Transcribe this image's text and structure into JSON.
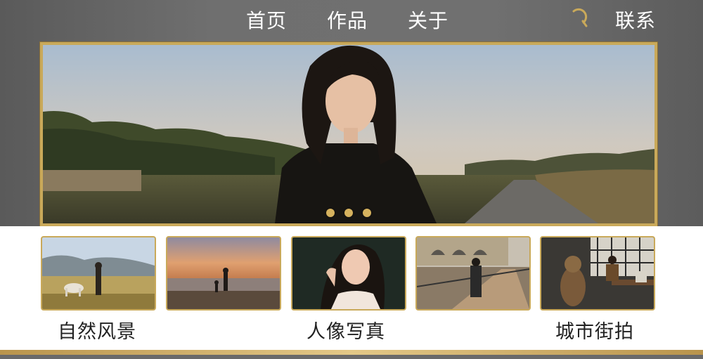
{
  "nav": {
    "home": "首页",
    "works": "作品",
    "about": "关于",
    "contact": "联系",
    "search_icon": "search-icon"
  },
  "hero": {
    "slide_count": 3,
    "active_slide": 1,
    "colors": {
      "frame": "#c9a95a",
      "dot": "#d6b25e"
    }
  },
  "thumbnails": [
    {
      "name": "landscape-horse"
    },
    {
      "name": "beach-sunset"
    },
    {
      "name": "portrait-woman"
    },
    {
      "name": "street-bridge"
    },
    {
      "name": "cafe-dog"
    }
  ],
  "categories": {
    "landscape": "自然风景",
    "portrait": "人像写真",
    "street": "城市街拍"
  },
  "colors": {
    "accent": "#c9a95a",
    "panel": "#ffffff"
  }
}
